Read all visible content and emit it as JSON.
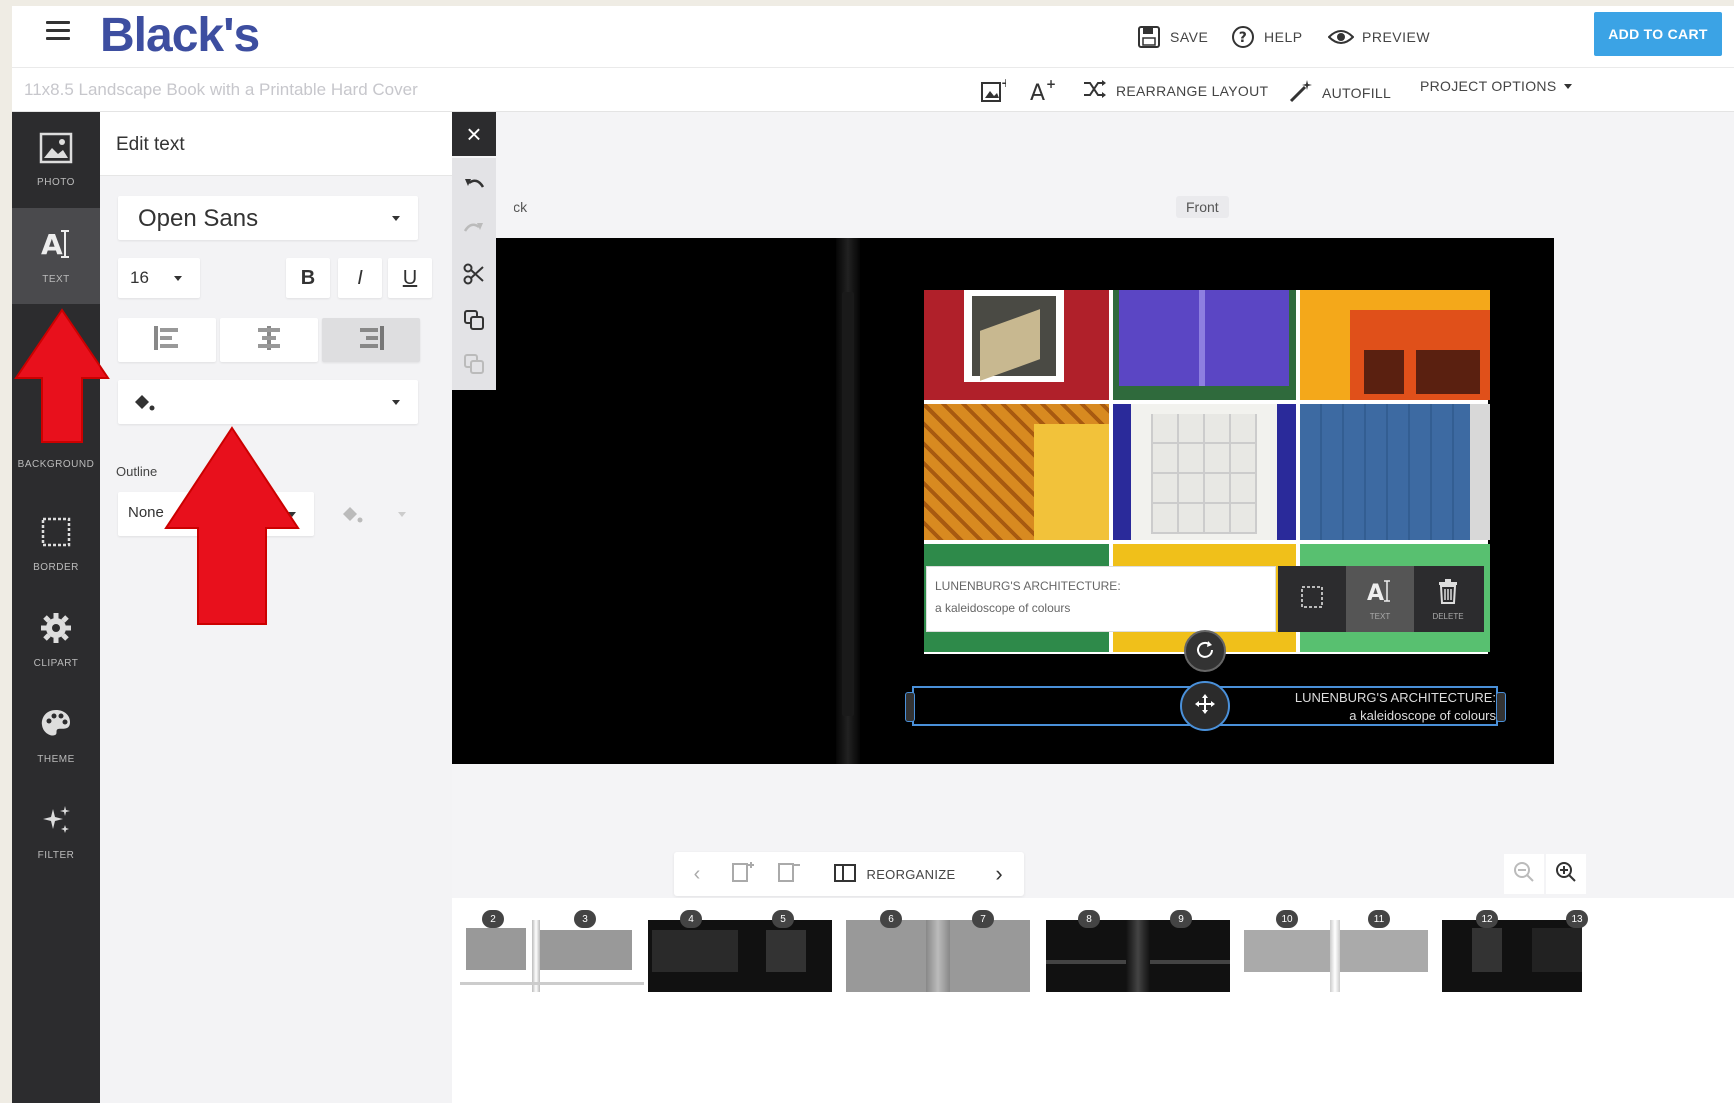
{
  "header": {
    "logo": "Black's",
    "save": "SAVE",
    "help": "HELP",
    "preview": "PREVIEW",
    "add_to_cart": "ADD TO CART"
  },
  "subheader": {
    "project_title": "11x8.5 Landscape Book with a Printable Hard Cover",
    "rearrange": "REARRANGE LAYOUT",
    "autofill": "AUTOFILL",
    "project_options": "PROJECT OPTIONS"
  },
  "rail": {
    "items": [
      {
        "label": "PHOTO",
        "icon": "image-icon"
      },
      {
        "label": "TEXT",
        "icon": "text-icon"
      },
      {
        "label": "BACKGROUND",
        "icon": "background-icon"
      },
      {
        "label": "BORDER",
        "icon": "border-icon"
      },
      {
        "label": "CLIPART",
        "icon": "gear-icon"
      },
      {
        "label": "THEME",
        "icon": "palette-icon"
      },
      {
        "label": "FILTER",
        "icon": "sparkle-icon"
      }
    ]
  },
  "panel": {
    "title": "Edit text",
    "font": "Open Sans",
    "size": "16",
    "bold": "B",
    "italic": "I",
    "underline": "U",
    "outline_label": "Outline",
    "outline_value": "None"
  },
  "canvas": {
    "back_label": "Back",
    "front_label": "Front",
    "caption_line1": "LUNENBURG'S ARCHITECTURE:",
    "caption_line2": "a kaleidoscope of colours",
    "cover_line1": "LUNENBURG'S ARCHITECTURE:",
    "cover_line2": "a kaleidoscope of colours",
    "float_text_label": "TEXT",
    "float_delete_label": "DELETE"
  },
  "pagenav": {
    "reorganize": "REORGANIZE"
  },
  "thumbnails": {
    "page_numbers": [
      "2",
      "3",
      "4",
      "5",
      "6",
      "7",
      "8",
      "9",
      "10",
      "11",
      "12",
      "13"
    ]
  },
  "colors": {
    "brand": "#3d4ea0",
    "cart": "#3ba3e5",
    "arrow": "#e8101c",
    "selection": "#4a90d9"
  }
}
